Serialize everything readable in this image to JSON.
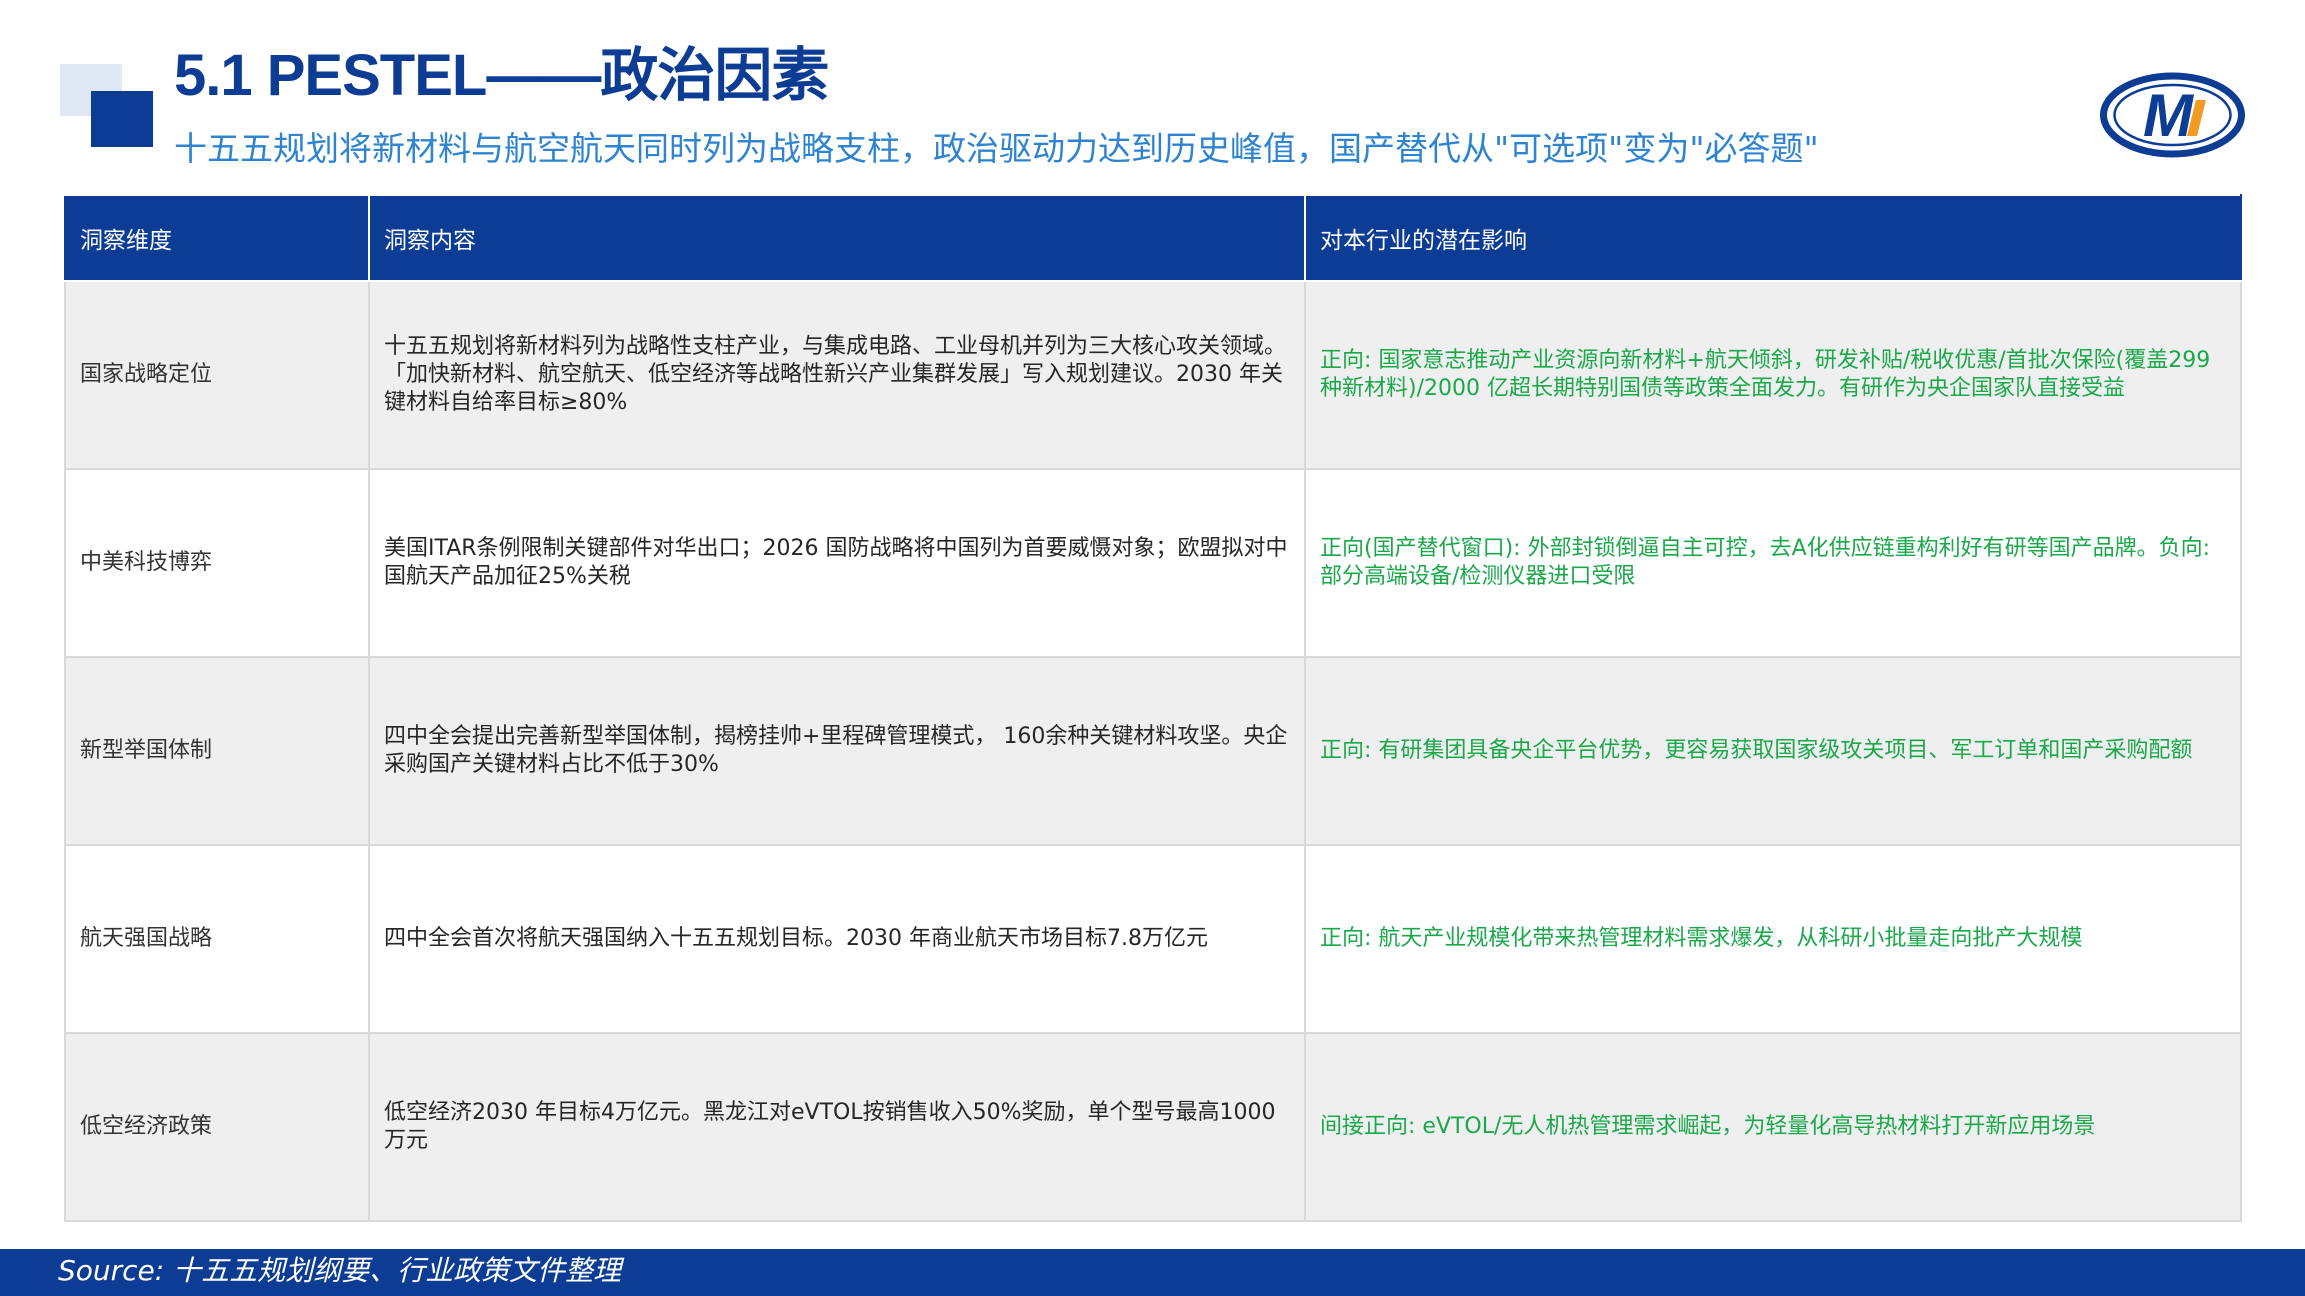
{
  "header": {
    "title": "5.1 PESTEL——政治因素",
    "subtitle": "十五五规划将新材料与航空航天同时列为战略支柱，政治驱动力达到历史峰值，国产替代从\"可选项\"变为\"必答题\"",
    "logo_letter": "M"
  },
  "colors": {
    "brand_navy": "#0c3c94",
    "subtitle_blue": "#2f84d2",
    "impact_green": "#1aa84b",
    "logo_orange": "#f29b20"
  },
  "table": {
    "headers": [
      "洞察维度",
      "洞察内容",
      "对本行业的潜在影响"
    ],
    "rows": [
      {
        "dimension": "国家战略定位",
        "content": "十五五规划将新材料列为战略性支柱产业，与集成电路、工业母机并列为三大核心攻关领域。「加快新材料、航空航天、低空经济等战略性新兴产业集群发展」写入规划建议。2030 年关键材料自给率目标≥80%",
        "impact": "正向: 国家意志推动产业资源向新材料+航天倾斜，研发补贴/税收优惠/首批次保险(覆盖299种新材料)/2000 亿超长期特别国债等政策全面发力。有研作为央企国家队直接受益"
      },
      {
        "dimension": "中美科技博弈",
        "content": "美国ITAR条例限制关键部件对华出口；2026 国防战略将中国列为首要威慑对象；欧盟拟对中国航天产品加征25%关税",
        "impact": "正向(国产替代窗口): 外部封锁倒逼自主可控，去A化供应链重构利好有研等国产品牌。负向: 部分高端设备/检测仪器进口受限"
      },
      {
        "dimension": "新型举国体制",
        "content": "四中全会提出完善新型举国体制，揭榜挂帅+里程碑管理模式， 160余种关键材料攻坚。央企采购国产关键材料占比不低于30%",
        "impact": "正向: 有研集团具备央企平台优势，更容易获取国家级攻关项目、军工订单和国产采购配额"
      },
      {
        "dimension": "航天强国战略",
        "content": "四中全会首次将航天强国纳入十五五规划目标。2030 年商业航天市场目标7.8万亿元",
        "impact": "正向: 航天产业规模化带来热管理材料需求爆发，从科研小批量走向批产大规模"
      },
      {
        "dimension": "低空经济政策",
        "content": "低空经济2030 年目标4万亿元。黑龙江对eVTOL按销售收入50%奖励，单个型号最高1000万元",
        "impact": "间接正向: eVTOL/无人机热管理需求崛起，为轻量化高导热材料打开新应用场景"
      }
    ]
  },
  "footer": {
    "source": "Source: 十五五规划纲要、行业政策文件整理"
  }
}
